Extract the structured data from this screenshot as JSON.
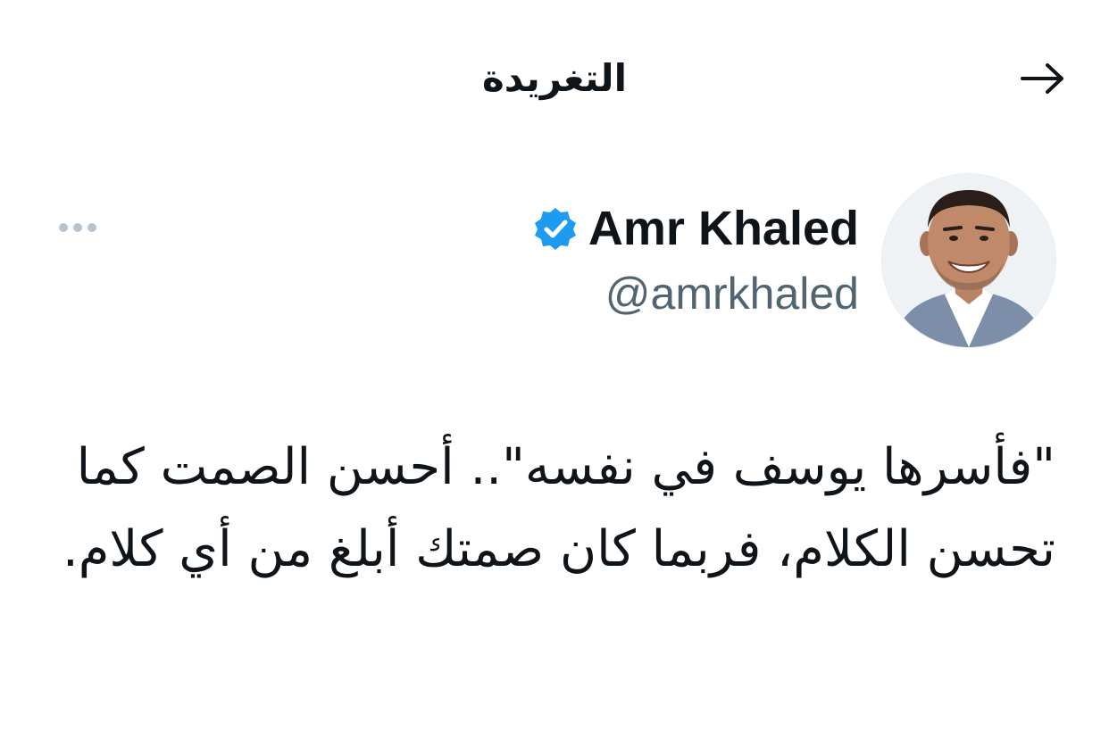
{
  "header": {
    "title": "التغريدة",
    "back_icon": "arrow-right-icon"
  },
  "tweet": {
    "author": {
      "display_name": "Amr Khaled",
      "handle": "@amrkhaled",
      "verified": true,
      "verified_icon": "verified-badge-icon",
      "verified_color": "#1d9bf0"
    },
    "more_icon": "more-horizontal-icon",
    "text": "\"فأسرها يوسف في نفسه\".. أحسن الصمت كما تحسن الكلام، فربما كان صمتك أبلغ من أي كلام."
  },
  "colors": {
    "text_primary": "#0f1419",
    "text_secondary": "#536471",
    "accent": "#1d9bf0"
  }
}
